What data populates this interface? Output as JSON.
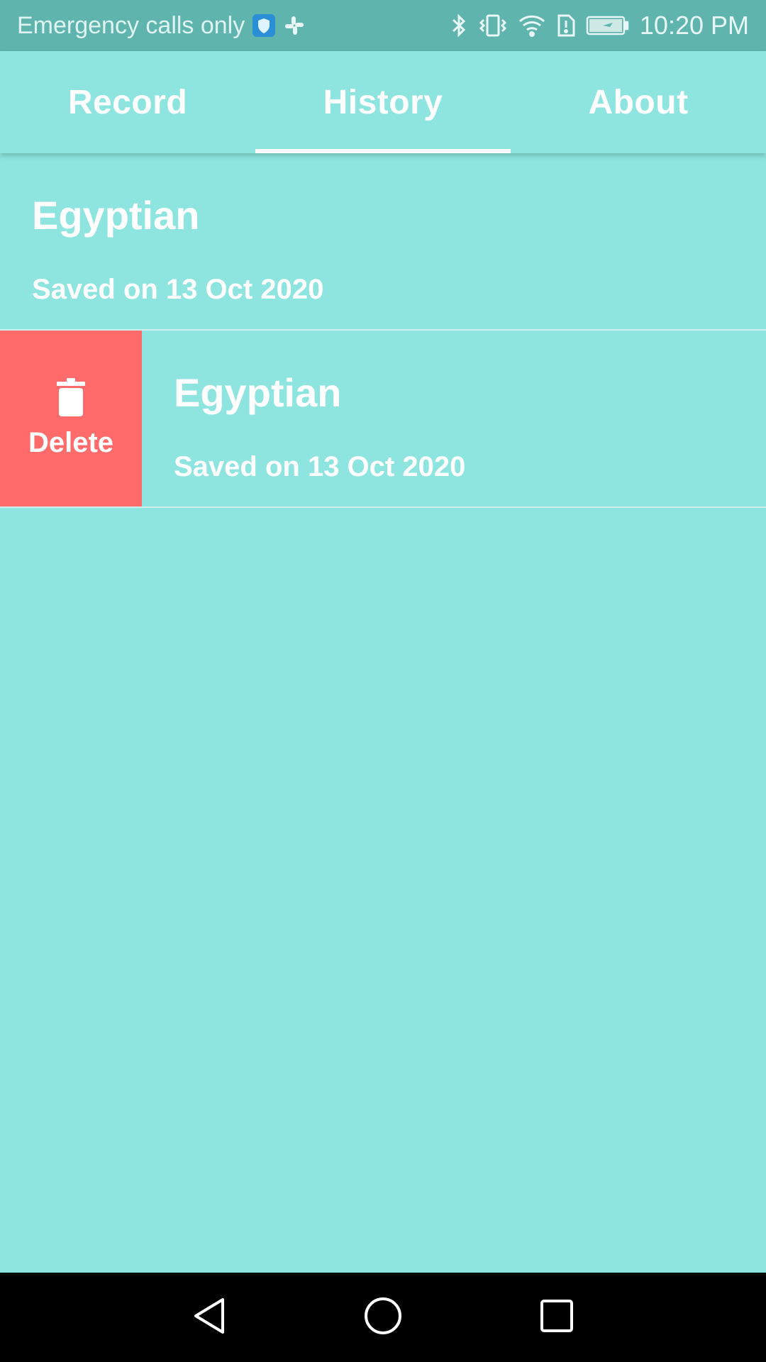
{
  "status_bar": {
    "carrier_text": "Emergency calls only",
    "time": "10:20 PM",
    "icons": [
      "shield-icon",
      "slack-icon",
      "bluetooth-icon",
      "vibrate-icon",
      "wifi-icon",
      "sim-alert-icon",
      "battery-charging-icon"
    ]
  },
  "tabs": [
    {
      "label": "Record",
      "selected": false
    },
    {
      "label": "History",
      "selected": true
    },
    {
      "label": "About",
      "selected": false
    }
  ],
  "history": {
    "items": [
      {
        "title": "Egyptian",
        "subtitle": "Saved on 13 Oct 2020",
        "swiped": false
      },
      {
        "title": "Egyptian",
        "subtitle": "Saved on 13 Oct 2020",
        "swiped": true
      }
    ],
    "delete_label": "Delete"
  },
  "colors": {
    "background": "#8EE5DF",
    "status_bar": "#5FB4AE",
    "delete": "#FF6B6B",
    "text": "#FFFFFF"
  },
  "navigation": {
    "buttons": [
      "back-icon",
      "home-icon",
      "recents-icon"
    ]
  }
}
